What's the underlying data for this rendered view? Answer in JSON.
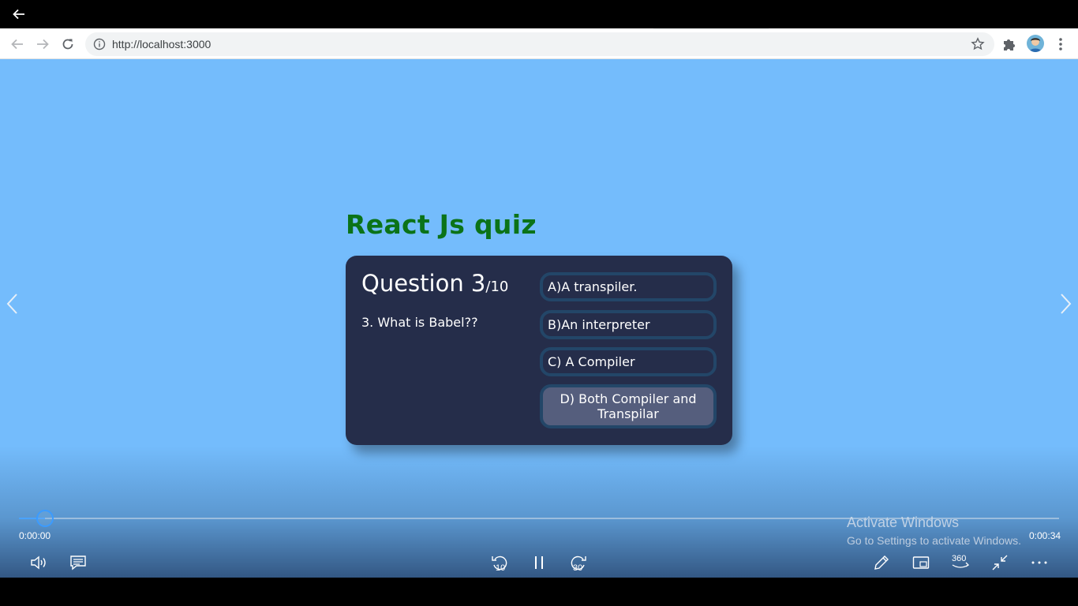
{
  "player": {
    "back_icon": "arrow-left-icon",
    "current_time": "0:00:00",
    "duration": "0:00:34",
    "progress_fraction": 0.025
  },
  "browser": {
    "url": "http://localhost:3000",
    "icons": [
      "back-icon",
      "forward-icon",
      "reload-icon",
      "info-icon",
      "star-icon",
      "puzzle-icon",
      "avatar",
      "more-vert-icon"
    ]
  },
  "quiz": {
    "title": "React Js quiz",
    "question_label": "Question 3",
    "question_total": "/10",
    "question_text": "3. What is Babel??",
    "answers": [
      {
        "label": "A)A transpiler."
      },
      {
        "label": "B)An interpreter"
      },
      {
        "label": "C) A Compiler"
      },
      {
        "label": "D) Both Compiler and Transpilar"
      }
    ],
    "colors": {
      "background": "#74bcfc",
      "card": "#252d4a",
      "title": "#0b7318",
      "answer_border": "#234668",
      "answer_hover": "#555e7d"
    }
  },
  "watermark": {
    "line1": "Activate Windows",
    "line2": "Go to Settings to activate Windows."
  },
  "controls": {
    "skip_back_label": "10",
    "skip_forward_label": "30",
    "view_360_label": "360"
  }
}
